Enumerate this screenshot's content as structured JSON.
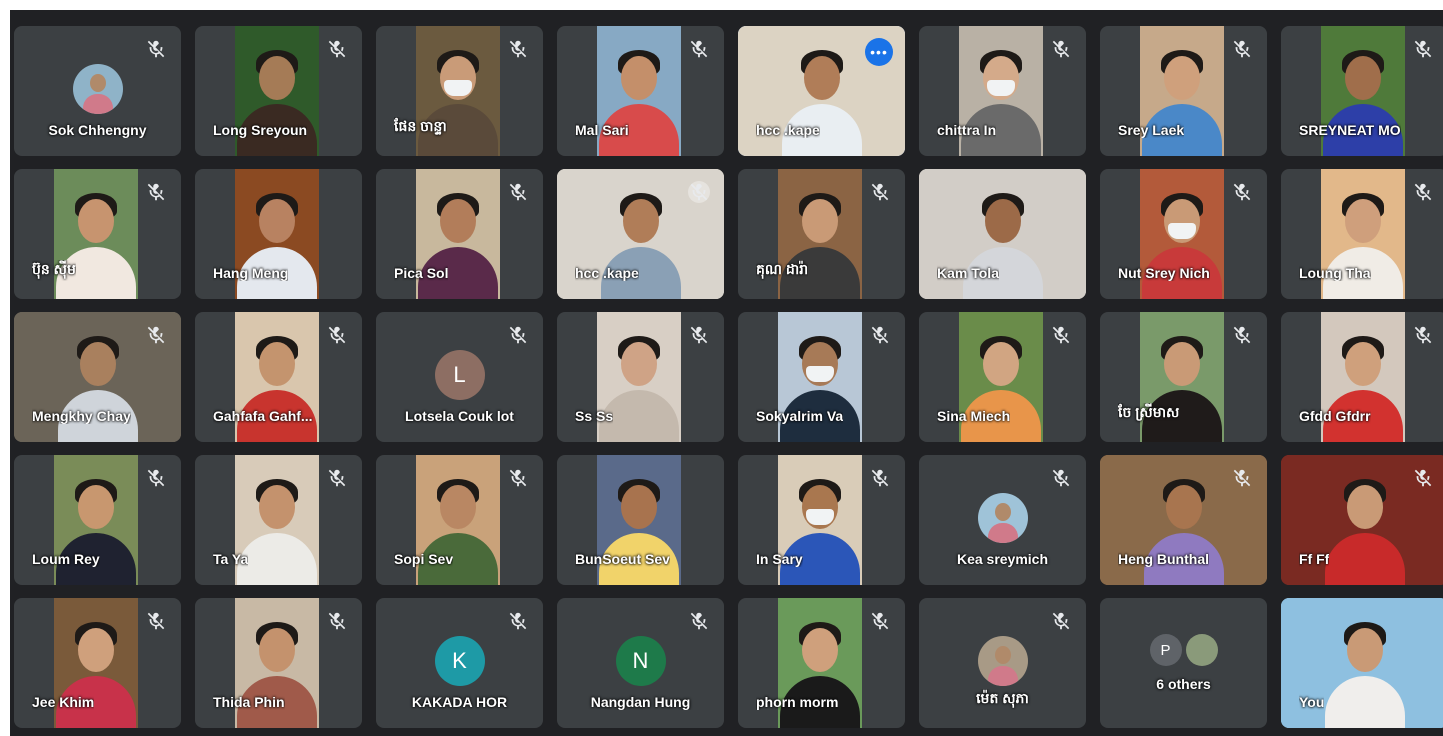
{
  "participants": [
    {
      "name": "Sok Chhengny",
      "type": "avatar-photo",
      "bg": "#3c4043",
      "accent": "#8fb3c8",
      "muted": true
    },
    {
      "name": "Long Sreyoun",
      "type": "video",
      "bg": "#2f5a2a",
      "skin": "#a57b56",
      "shirt": "#3a2a22",
      "muted": true
    },
    {
      "name": "ផែន ចាន្ទា",
      "type": "video",
      "bg": "#6b5a3f",
      "skin": "#c99b78",
      "shirt": "#5a4a3a",
      "mask": true,
      "muted": true
    },
    {
      "name": "Mal Sari",
      "type": "video",
      "bg": "#87a9c4",
      "skin": "#c48f6a",
      "shirt": "#d84b4b",
      "muted": true
    },
    {
      "name": "hcc .kape",
      "type": "video-full",
      "bg": "#dcd3c3",
      "skin": "#b07d58",
      "shirt": "#e9eef2",
      "active": true,
      "more": "•••"
    },
    {
      "name": "chittra In",
      "type": "video",
      "bg": "#b9b1a5",
      "skin": "#d4aa8a",
      "shirt": "#6a6a6a",
      "mask": true,
      "muted": true
    },
    {
      "name": "Srey Laek",
      "type": "video",
      "bg": "#c6a98a",
      "skin": "#cfa07c",
      "shirt": "#4a88c8",
      "muted": true
    },
    {
      "name": "SREYNEAT MO",
      "type": "video",
      "bg": "#4f7a3a",
      "skin": "#a06e4b",
      "shirt": "#2d3fa8",
      "muted": true
    },
    {
      "name": "ប៊ុន ស៊ីម",
      "type": "video",
      "bg": "#6c8c5a",
      "skin": "#c7946f",
      "shirt": "#f1e8e0",
      "muted": true
    },
    {
      "name": "Hang Meng",
      "type": "video",
      "bg": "#8b4a22",
      "skin": "#b88261",
      "shirt": "#e4e8ee",
      "muted": false
    },
    {
      "name": "Pica Sol",
      "type": "video",
      "bg": "#c8b89d",
      "skin": "#b27d5a",
      "shirt": "#5a2a4a",
      "muted": true
    },
    {
      "name": "hcc .kape",
      "type": "video-full",
      "bg": "#d9d4cc",
      "skin": "#b07d58",
      "shirt": "#8aa0b5",
      "muted": true,
      "mute_circle": true
    },
    {
      "name": "គុណ ដារ៉ា",
      "type": "video",
      "bg": "#8b6444",
      "skin": "#c99a76",
      "shirt": "#3a3a3a",
      "muted": true
    },
    {
      "name": "Kam Tola",
      "type": "video-full",
      "bg": "#d2cdc7",
      "skin": "#9c6a48",
      "shirt": "#d4d6da",
      "muted": false
    },
    {
      "name": "Nut Srey Nich",
      "type": "video",
      "bg": "#b35a3a",
      "skin": "#c99a76",
      "shirt": "#c83a3a",
      "mask": true,
      "muted": true
    },
    {
      "name": "Loung Tha",
      "type": "video",
      "bg": "#e2b88a",
      "skin": "#cf9f7c",
      "shirt": "#f0ece6",
      "muted": true
    },
    {
      "name": "Mengkhy Chay",
      "type": "video-full",
      "bg": "#6b6458",
      "skin": "#a9805e",
      "shirt": "#cfd4da",
      "muted": true
    },
    {
      "name": "Gahfafa Gahf...",
      "type": "video",
      "bg": "#d9c6ad",
      "skin": "#c4946e",
      "shirt": "#c8342e",
      "muted": true
    },
    {
      "name": "Lotsela Couk lot",
      "type": "avatar-letter",
      "letter": "L",
      "bg": "#3c4043",
      "accent": "#8d6e63",
      "muted": true
    },
    {
      "name": "Ss Ss",
      "type": "video",
      "bg": "#d8cfc5",
      "skin": "#cfa386",
      "shirt": "#c4b9ad",
      "muted": true
    },
    {
      "name": "Sokyalrim Va",
      "type": "video",
      "bg": "#b8c7d6",
      "skin": "#a77a57",
      "shirt": "#1e2d3e",
      "mask": true,
      "muted": true
    },
    {
      "name": "Sina Miech",
      "type": "video",
      "bg": "#6a8c4a",
      "skin": "#d1a582",
      "shirt": "#e8954a",
      "muted": true
    },
    {
      "name": "ចែ ស្រីមាស",
      "type": "video",
      "bg": "#7a9a6a",
      "skin": "#c99a76",
      "shirt": "#1f1b1a",
      "muted": true
    },
    {
      "name": "Gfdd Gfdrr",
      "type": "video",
      "bg": "#d3c8bd",
      "skin": "#cfa07c",
      "shirt": "#d2322f",
      "muted": true
    },
    {
      "name": "Loum Rey",
      "type": "video",
      "bg": "#7a8c58",
      "skin": "#c8976f",
      "shirt": "#1f2230",
      "muted": true
    },
    {
      "name": "Ta Ya",
      "type": "video",
      "bg": "#d8cbb9",
      "skin": "#c4926d",
      "shirt": "#ecebe7",
      "muted": true
    },
    {
      "name": "Sopi Sev",
      "type": "video",
      "bg": "#c9a27a",
      "skin": "#b98763",
      "shirt": "#4a6a3a",
      "muted": true
    },
    {
      "name": "BunSoeut Sev",
      "type": "video",
      "bg": "#5a6a8a",
      "skin": "#a8734e",
      "shirt": "#f1d36a",
      "muted": false
    },
    {
      "name": "In Sary",
      "type": "video",
      "bg": "#d9ccb8",
      "skin": "#a9774f",
      "shirt": "#2b56b8",
      "mask": true,
      "muted": true
    },
    {
      "name": "Kea sreymich",
      "type": "avatar-photo",
      "bg": "#3c4043",
      "accent": "#9fc3d8",
      "muted": true
    },
    {
      "name": "Heng Bunthal",
      "type": "video-full",
      "bg": "#8a6a4a",
      "skin": "#a8754f",
      "shirt": "#8f7ac0",
      "muted": true
    },
    {
      "name": "Ff Ff",
      "type": "video-full",
      "bg": "#7a2a22",
      "skin": "#c99a76",
      "shirt": "#c82a2a",
      "muted": true
    },
    {
      "name": "Jee Khim",
      "type": "video",
      "bg": "#7a5a3a",
      "skin": "#cfa07c",
      "shirt": "#c8324a",
      "muted": true
    },
    {
      "name": "Thida Phin",
      "type": "video",
      "bg": "#c8b9a5",
      "skin": "#c4926d",
      "shirt": "#a05a4a",
      "muted": true
    },
    {
      "name": "KAKADA HOR",
      "type": "avatar-letter",
      "letter": "K",
      "bg": "#3c4043",
      "accent": "#1e9aa6",
      "muted": true
    },
    {
      "name": "Nangdan Hung",
      "type": "avatar-letter",
      "letter": "N",
      "bg": "#3c4043",
      "accent": "#1e7a4a",
      "muted": true
    },
    {
      "name": "phorn morm",
      "type": "video",
      "bg": "#6a9a5a",
      "skin": "#cfa07c",
      "shirt": "#1a1a1a",
      "muted": true
    },
    {
      "name": "ម៉េត សុភា",
      "type": "avatar-photo",
      "bg": "#3c4043",
      "accent": "#a89a86",
      "muted": true
    },
    {
      "name": "6 others",
      "type": "others",
      "letters": [
        "P",
        ""
      ],
      "bg": "#3c4043",
      "muted": false
    },
    {
      "name": "You",
      "type": "video-full",
      "bg": "#8ec0e0",
      "skin": "#c99a76",
      "shirt": "#f0eeec",
      "muted": false
    }
  ],
  "icons": {
    "mute": "mic-off-icon",
    "more": "more-options-icon"
  }
}
